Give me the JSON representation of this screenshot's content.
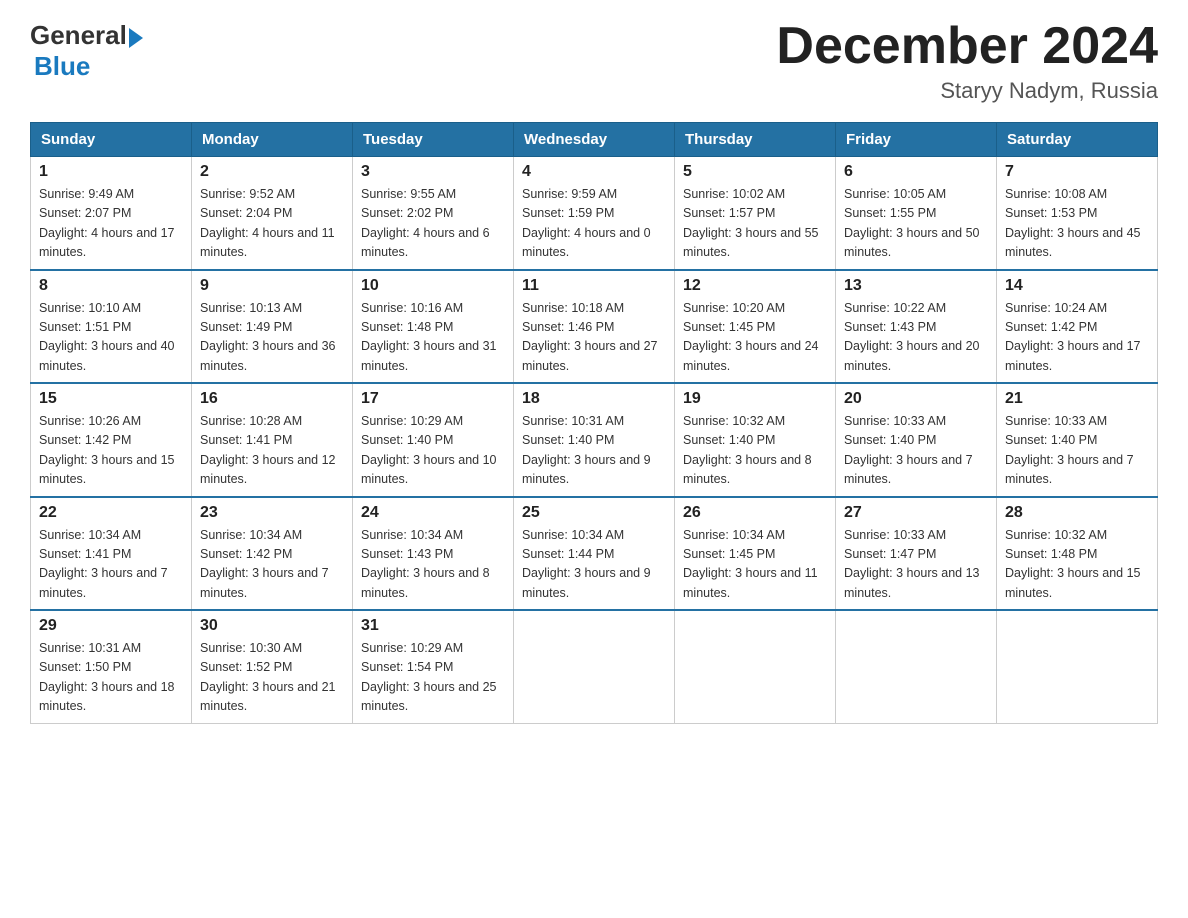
{
  "header": {
    "logo": {
      "general": "General",
      "blue": "Blue"
    },
    "title": "December 2024",
    "location": "Staryy Nadym, Russia"
  },
  "days_of_week": [
    "Sunday",
    "Monday",
    "Tuesday",
    "Wednesday",
    "Thursday",
    "Friday",
    "Saturday"
  ],
  "weeks": [
    [
      {
        "day": "1",
        "sunrise": "9:49 AM",
        "sunset": "2:07 PM",
        "daylight": "4 hours and 17 minutes."
      },
      {
        "day": "2",
        "sunrise": "9:52 AM",
        "sunset": "2:04 PM",
        "daylight": "4 hours and 11 minutes."
      },
      {
        "day": "3",
        "sunrise": "9:55 AM",
        "sunset": "2:02 PM",
        "daylight": "4 hours and 6 minutes."
      },
      {
        "day": "4",
        "sunrise": "9:59 AM",
        "sunset": "1:59 PM",
        "daylight": "4 hours and 0 minutes."
      },
      {
        "day": "5",
        "sunrise": "10:02 AM",
        "sunset": "1:57 PM",
        "daylight": "3 hours and 55 minutes."
      },
      {
        "day": "6",
        "sunrise": "10:05 AM",
        "sunset": "1:55 PM",
        "daylight": "3 hours and 50 minutes."
      },
      {
        "day": "7",
        "sunrise": "10:08 AM",
        "sunset": "1:53 PM",
        "daylight": "3 hours and 45 minutes."
      }
    ],
    [
      {
        "day": "8",
        "sunrise": "10:10 AM",
        "sunset": "1:51 PM",
        "daylight": "3 hours and 40 minutes."
      },
      {
        "day": "9",
        "sunrise": "10:13 AM",
        "sunset": "1:49 PM",
        "daylight": "3 hours and 36 minutes."
      },
      {
        "day": "10",
        "sunrise": "10:16 AM",
        "sunset": "1:48 PM",
        "daylight": "3 hours and 31 minutes."
      },
      {
        "day": "11",
        "sunrise": "10:18 AM",
        "sunset": "1:46 PM",
        "daylight": "3 hours and 27 minutes."
      },
      {
        "day": "12",
        "sunrise": "10:20 AM",
        "sunset": "1:45 PM",
        "daylight": "3 hours and 24 minutes."
      },
      {
        "day": "13",
        "sunrise": "10:22 AM",
        "sunset": "1:43 PM",
        "daylight": "3 hours and 20 minutes."
      },
      {
        "day": "14",
        "sunrise": "10:24 AM",
        "sunset": "1:42 PM",
        "daylight": "3 hours and 17 minutes."
      }
    ],
    [
      {
        "day": "15",
        "sunrise": "10:26 AM",
        "sunset": "1:42 PM",
        "daylight": "3 hours and 15 minutes."
      },
      {
        "day": "16",
        "sunrise": "10:28 AM",
        "sunset": "1:41 PM",
        "daylight": "3 hours and 12 minutes."
      },
      {
        "day": "17",
        "sunrise": "10:29 AM",
        "sunset": "1:40 PM",
        "daylight": "3 hours and 10 minutes."
      },
      {
        "day": "18",
        "sunrise": "10:31 AM",
        "sunset": "1:40 PM",
        "daylight": "3 hours and 9 minutes."
      },
      {
        "day": "19",
        "sunrise": "10:32 AM",
        "sunset": "1:40 PM",
        "daylight": "3 hours and 8 minutes."
      },
      {
        "day": "20",
        "sunrise": "10:33 AM",
        "sunset": "1:40 PM",
        "daylight": "3 hours and 7 minutes."
      },
      {
        "day": "21",
        "sunrise": "10:33 AM",
        "sunset": "1:40 PM",
        "daylight": "3 hours and 7 minutes."
      }
    ],
    [
      {
        "day": "22",
        "sunrise": "10:34 AM",
        "sunset": "1:41 PM",
        "daylight": "3 hours and 7 minutes."
      },
      {
        "day": "23",
        "sunrise": "10:34 AM",
        "sunset": "1:42 PM",
        "daylight": "3 hours and 7 minutes."
      },
      {
        "day": "24",
        "sunrise": "10:34 AM",
        "sunset": "1:43 PM",
        "daylight": "3 hours and 8 minutes."
      },
      {
        "day": "25",
        "sunrise": "10:34 AM",
        "sunset": "1:44 PM",
        "daylight": "3 hours and 9 minutes."
      },
      {
        "day": "26",
        "sunrise": "10:34 AM",
        "sunset": "1:45 PM",
        "daylight": "3 hours and 11 minutes."
      },
      {
        "day": "27",
        "sunrise": "10:33 AM",
        "sunset": "1:47 PM",
        "daylight": "3 hours and 13 minutes."
      },
      {
        "day": "28",
        "sunrise": "10:32 AM",
        "sunset": "1:48 PM",
        "daylight": "3 hours and 15 minutes."
      }
    ],
    [
      {
        "day": "29",
        "sunrise": "10:31 AM",
        "sunset": "1:50 PM",
        "daylight": "3 hours and 18 minutes."
      },
      {
        "day": "30",
        "sunrise": "10:30 AM",
        "sunset": "1:52 PM",
        "daylight": "3 hours and 21 minutes."
      },
      {
        "day": "31",
        "sunrise": "10:29 AM",
        "sunset": "1:54 PM",
        "daylight": "3 hours and 25 minutes."
      },
      null,
      null,
      null,
      null
    ]
  ]
}
